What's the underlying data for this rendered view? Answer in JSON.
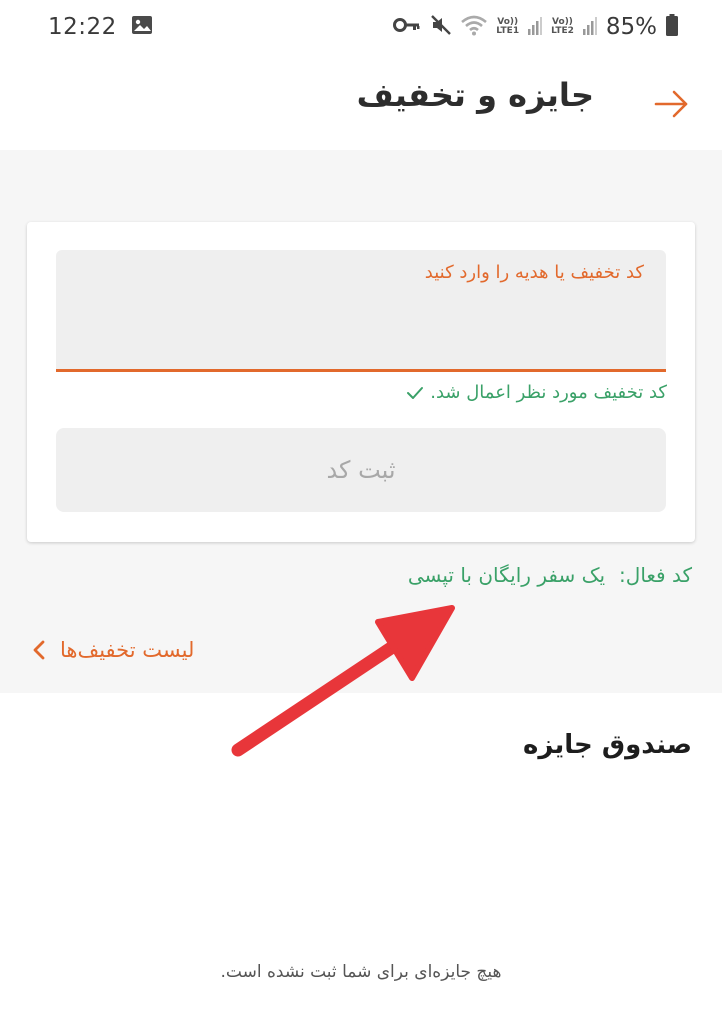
{
  "status_bar": {
    "time": "12:22",
    "battery": "85%",
    "sim1": {
      "top": "Vo))",
      "bottom": "LTE1"
    },
    "sim2": {
      "top": "Vo))",
      "bottom": "LTE2"
    },
    "icons": [
      "image-icon",
      "key-icon",
      "mute-icon",
      "wifi-icon",
      "signal-icon",
      "battery-icon"
    ]
  },
  "header": {
    "title": "جایزه و تخفیف",
    "back_icon": "arrow-right-icon"
  },
  "promo": {
    "input_label": "کد تخفیف یا هدیه را وارد کنید",
    "input_value": "",
    "success_message": "کد تخفیف مورد نظر اعمال شد.",
    "submit_label": "ثبت کد"
  },
  "active_code": {
    "label": "کد فعال:",
    "value": "یک سفر رایگان با تپسی"
  },
  "discount_list": {
    "label": "لیست تخفیف‌ها"
  },
  "prize_box": {
    "title": "صندوق جایزه",
    "empty_message": "هیچ جایزه‌ای برای شما ثبت نشده است."
  },
  "colors": {
    "accent": "#e2692c",
    "success": "#3aa168",
    "annotation_arrow": "#e8363a"
  }
}
